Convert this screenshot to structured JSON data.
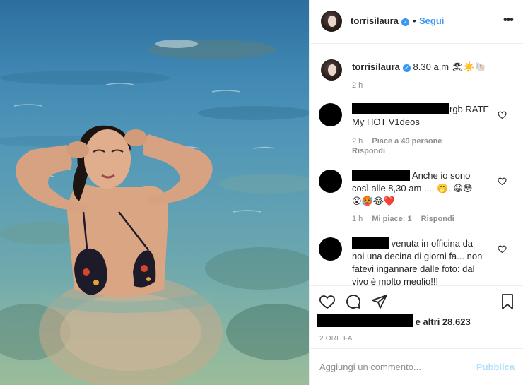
{
  "post": {
    "username": "torrisilaura",
    "verified_icon": "verified-badge-icon",
    "follow_label": "Segui",
    "separator": "•",
    "more_label": "•••"
  },
  "caption": {
    "username": "torrisilaura",
    "text": "8.30 a.m",
    "emojis": "🏖☀️🐚",
    "time": "2 h"
  },
  "comments": [
    {
      "text_line1": "rgb RATE",
      "text_line2": "My HOT V1deos",
      "time": "2 h",
      "likes": "Piace a 49 persone",
      "reply": "Rispondi"
    },
    {
      "text_line1": "Anche io sono",
      "text_line2": "così alle 8,30 am .... 🤭. 😀😳",
      "text_line3": "😮🥵😂❤️",
      "time": "1 h",
      "likes": "Mi piace: 1",
      "reply": "Rispondi"
    },
    {
      "text_line1": "venuta in officina da",
      "text_line2": "noi una decina di giorni fa... non",
      "text_line3": "fatevi ingannare dalle foto: dal",
      "text_line4": "vivo è molto meglio!!!"
    }
  ],
  "likes_summary": {
    "others": "e altri 28.623"
  },
  "post_time": "2 ORE FA",
  "comment_box": {
    "placeholder": "Aggiungi un commento...",
    "publish_label": "Pubblica"
  },
  "colors": {
    "link_blue": "#3897f0",
    "publish_disabled": "#b2dffc",
    "muted_text": "#8e8e8e"
  }
}
